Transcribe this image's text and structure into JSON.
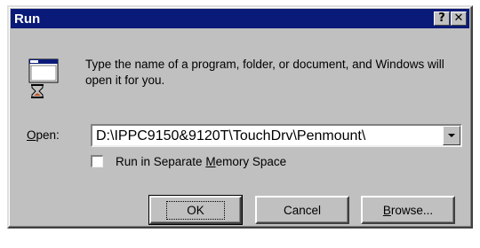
{
  "window": {
    "title": "Run",
    "help_glyph": "?",
    "close_glyph": "✕"
  },
  "icons": {
    "app": "run-program-icon",
    "help": "help-icon",
    "close": "close-icon",
    "dropdown": "chevron-down-icon"
  },
  "description": "Type the name of a program, folder, or document, and Windows will open it for you.",
  "open": {
    "label_accel": "O",
    "label_rest": "pen:",
    "value": "D:\\IPPC9150&9120T\\TouchDrv\\Penmount\\"
  },
  "memory_option": {
    "label_before": "Run in Separate ",
    "label_accel": "M",
    "label_after": "emory Space",
    "checked": false
  },
  "buttons": {
    "ok": "OK",
    "cancel": "Cancel",
    "browse_accel": "B",
    "browse_rest": "rowse..."
  },
  "colors": {
    "title_bar": "#0a1a78",
    "face": "#c0c0c0"
  }
}
